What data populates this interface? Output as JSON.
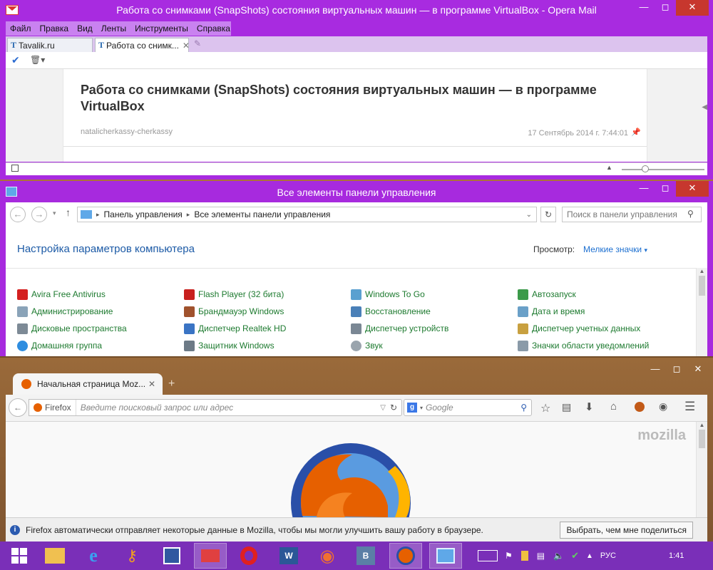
{
  "colors": {
    "window_frame": "#a82be0",
    "close_button": "#c7372e",
    "link_blue": "#1c5aa6",
    "cp_item_green": "#1d7a2f",
    "taskbar": "#7a2fb8"
  },
  "opera": {
    "title": "Работа со снимками (SnapShots) состояния виртуальных машин — в программе VirtualBox - Opera Mail",
    "menu": [
      "Файл",
      "Правка",
      "Вид",
      "Ленты",
      "Инструменты",
      "Справка"
    ],
    "tabs": [
      {
        "label": "Tavalik.ru"
      },
      {
        "label": "Работа со снимк..."
      }
    ],
    "article": {
      "title": "Работа со снимками (SnapShots) состояния виртуальных машин — в программе VirtualBox",
      "author": "natalicherkassy-cherkassy",
      "date": "17 Сентябрь 2014 г. 7:44:01"
    }
  },
  "control_panel": {
    "title": "Все элементы панели управления",
    "breadcrumb": [
      "Панель управления",
      "Все элементы панели управления"
    ],
    "search_placeholder": "Поиск в панели управления",
    "heading": "Настройка параметров компьютера",
    "view_label": "Просмотр:",
    "view_value": "Мелкие значки",
    "columns": [
      [
        "Avira Free Antivirus",
        "Администрирование",
        "Дисковые пространства",
        "Домашняя группа"
      ],
      [
        "Flash Player (32 бита)",
        "Брандмауэр Windows",
        "Диспетчер Realtek HD",
        "Защитник Windows"
      ],
      [
        "Windows To Go",
        "Восстановление",
        "Диспетчер устройств",
        "Звук"
      ],
      [
        "Автозапуск",
        "Дата и время",
        "Диспетчер учетных данных",
        "Значки области уведомлений"
      ]
    ]
  },
  "firefox": {
    "tab_label": "Начальная страница Moz...",
    "identity_label": "Firefox",
    "url_placeholder": "Введите поисковый запрос или адрес",
    "search_engine_placeholder": "Google",
    "brand": "mozilla",
    "notification": "Firefox автоматически отправляет некоторые данные в Mozilla, чтобы мы могли улучшить вашу работу в браузере.",
    "notification_button": "Выбрать, чем мне поделиться"
  },
  "taskbar": {
    "language": "РУС",
    "time": "1:41"
  }
}
